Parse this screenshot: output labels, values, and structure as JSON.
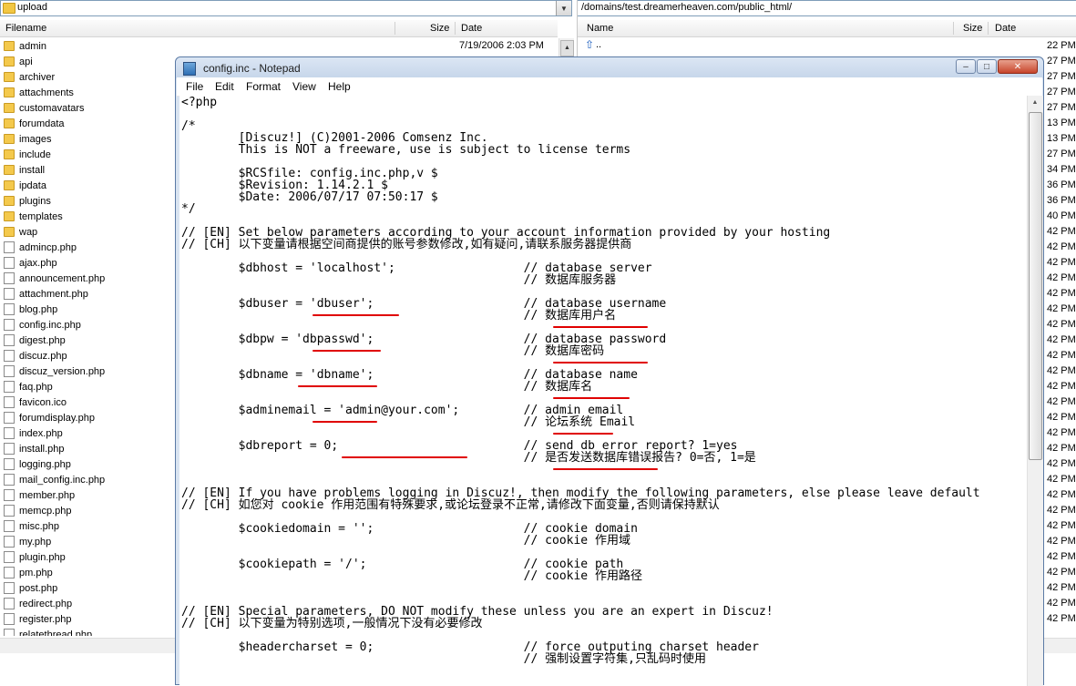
{
  "ftp": {
    "left": {
      "path": "upload",
      "columns": {
        "filename": "Filename",
        "size": "Size",
        "date": "Date"
      },
      "first_date": "7/19/2006 2:03 PM",
      "items": [
        {
          "name": "admin",
          "type": "folder"
        },
        {
          "name": "api",
          "type": "folder"
        },
        {
          "name": "archiver",
          "type": "folder"
        },
        {
          "name": "attachments",
          "type": "folder"
        },
        {
          "name": "customavatars",
          "type": "folder"
        },
        {
          "name": "forumdata",
          "type": "folder"
        },
        {
          "name": "images",
          "type": "folder"
        },
        {
          "name": "include",
          "type": "folder"
        },
        {
          "name": "install",
          "type": "folder"
        },
        {
          "name": "ipdata",
          "type": "folder"
        },
        {
          "name": "plugins",
          "type": "folder"
        },
        {
          "name": "templates",
          "type": "folder"
        },
        {
          "name": "wap",
          "type": "folder"
        },
        {
          "name": "admincp.php",
          "type": "file"
        },
        {
          "name": "ajax.php",
          "type": "file"
        },
        {
          "name": "announcement.php",
          "type": "file"
        },
        {
          "name": "attachment.php",
          "type": "file"
        },
        {
          "name": "blog.php",
          "type": "file"
        },
        {
          "name": "config.inc.php",
          "type": "file"
        },
        {
          "name": "digest.php",
          "type": "file"
        },
        {
          "name": "discuz.php",
          "type": "file"
        },
        {
          "name": "discuz_version.php",
          "type": "file"
        },
        {
          "name": "faq.php",
          "type": "file"
        },
        {
          "name": "favicon.ico",
          "type": "file"
        },
        {
          "name": "forumdisplay.php",
          "type": "file"
        },
        {
          "name": "index.php",
          "type": "file"
        },
        {
          "name": "install.php",
          "type": "file"
        },
        {
          "name": "logging.php",
          "type": "file"
        },
        {
          "name": "mail_config.inc.php",
          "type": "file"
        },
        {
          "name": "member.php",
          "type": "file"
        },
        {
          "name": "memcp.php",
          "type": "file"
        },
        {
          "name": "misc.php",
          "type": "file"
        },
        {
          "name": "my.php",
          "type": "file"
        },
        {
          "name": "plugin.php",
          "type": "file"
        },
        {
          "name": "pm.php",
          "type": "file"
        },
        {
          "name": "post.php",
          "type": "file"
        },
        {
          "name": "redirect.php",
          "type": "file"
        },
        {
          "name": "register.php",
          "type": "file"
        },
        {
          "name": "relatethread.php",
          "type": "file"
        }
      ]
    },
    "right": {
      "path": "/domains/test.dreamerheaven.com/public_html/",
      "columns": {
        "name": "Name",
        "size": "Size",
        "date": "Date"
      },
      "parent": "..",
      "times": [
        "22 PM",
        "27 PM",
        "27 PM",
        "27 PM",
        "27 PM",
        "13 PM",
        "13 PM",
        "27 PM",
        "34 PM",
        "36 PM",
        "36 PM",
        "40 PM",
        "42 PM",
        "42 PM",
        "42 PM",
        "42 PM",
        "42 PM",
        "42 PM",
        "42 PM",
        "42 PM",
        "42 PM",
        "42 PM",
        "42 PM",
        "42 PM",
        "42 PM",
        "42 PM",
        "42 PM",
        "42 PM",
        "42 PM",
        "42 PM",
        "42 PM",
        "42 PM",
        "42 PM",
        "42 PM",
        "42 PM",
        "42 PM",
        "42 PM",
        "42 PM"
      ]
    }
  },
  "notepad": {
    "title": "config.inc - Notepad",
    "window_buttons": {
      "minimize": "–",
      "maximize": "□",
      "close": "✕"
    },
    "menu": [
      "File",
      "Edit",
      "Format",
      "View",
      "Help"
    ],
    "underline_color": "#e00000",
    "lines": [
      "<?php",
      "",
      "/*",
      "        [Discuz!] (C)2001-2006 Comsenz Inc.",
      "        This is NOT a freeware, use is subject to license terms",
      "",
      "        $RCSfile: config.inc.php,v $",
      "        $Revision: 1.14.2.1 $",
      "        $Date: 2006/07/17 07:50:17 $",
      "*/",
      "",
      "// [EN] Set below parameters according to your account information provided by your hosting",
      "// [CH] 以下变量请根据空间商提供的账号参数修改,如有疑问,请联系服务器提供商",
      "",
      "        $dbhost = 'localhost';                  // database server",
      "                                                // 数据库服务器",
      "",
      "        $dbuser = 'dbuser';                     // database username",
      "                                                // 数据库用户名",
      "",
      "        $dbpw = 'dbpasswd';                     // database password",
      "                                                // 数据库密码",
      "",
      "        $dbname = 'dbname';                     // database name",
      "                                                // 数据库名",
      "",
      "        $adminemail = 'admin@your.com';         // admin email",
      "                                                // 论坛系统 Email",
      "",
      "        $dbreport = 0;                          // send db error report? 1=yes",
      "                                                // 是否发送数据库错误报告? 0=否, 1=是",
      "",
      "",
      "// [EN] If you have problems logging in Discuz!, then modify the following parameters, else please leave default",
      "// [CH] 如您对 cookie 作用范围有特殊要求,或论坛登录不正常,请修改下面变量,否则请保持默认",
      "",
      "        $cookiedomain = '';                     // cookie domain",
      "                                                // cookie 作用域",
      "",
      "        $cookiepath = '/';                      // cookie path",
      "                                                // cookie 作用路径",
      "",
      "",
      "// [EN] Special parameters, DO NOT modify these unless you are an expert in Discuz!",
      "// [CH] 以下变量为特别选项,一般情况下没有必要修改",
      "",
      "        $headercharset = 0;                     // force outputing charset header",
      "                                                // 强制设置字符集,只乱码时使用"
    ]
  }
}
